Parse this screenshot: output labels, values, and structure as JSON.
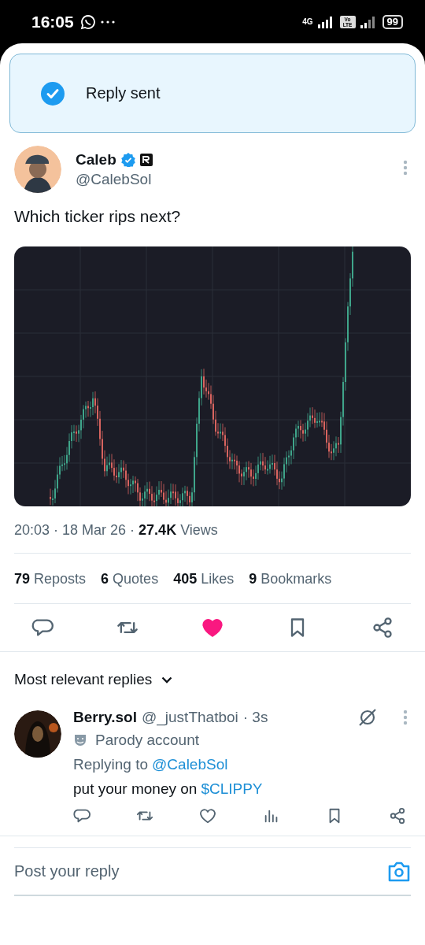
{
  "status_bar": {
    "time": "16:05",
    "network": "4G",
    "volte": "Vo LTE",
    "battery": "99"
  },
  "toast": {
    "message": "Reply sent"
  },
  "post": {
    "author": "Caleb",
    "verified": true,
    "handle": "@CalebSol",
    "text": "Which ticker rips next?",
    "meta": "20:03 · 18 Mar 26 · **27.4K** Views",
    "stats": [
      {
        "count": "79",
        "label": "Reposts"
      },
      {
        "count": "6",
        "label": "Quotes"
      },
      {
        "count": "405",
        "label": "Likes"
      },
      {
        "count": "9",
        "label": "Bookmarks"
      }
    ],
    "actions": [
      {
        "kind": "reply",
        "on": false
      },
      {
        "kind": "repost",
        "on": false
      },
      {
        "kind": "like",
        "on": true
      },
      {
        "kind": "bookmark",
        "on": false
      },
      {
        "kind": "share",
        "on": false
      }
    ]
  },
  "replies_sort": {
    "label": "Most relevant replies"
  },
  "replies": [
    {
      "author": "Berry.sol",
      "handle": "@_justThatboi",
      "time": "· 3s",
      "badge": "Parody account",
      "replying_label": "Replying to",
      "replying_to": "@CalebSol",
      "text": "put your money on",
      "tag": "$CLIPPY",
      "actions": [
        {
          "kind": "reply",
          "on": false
        },
        {
          "kind": "repost",
          "on": false
        },
        {
          "kind": "like",
          "on": false
        },
        {
          "kind": "views",
          "on": false
        },
        {
          "kind": "bookmark",
          "on": false
        },
        {
          "kind": "share",
          "on": false
        }
      ]
    }
  ],
  "composer": {
    "placeholder": "Post your reply"
  }
}
